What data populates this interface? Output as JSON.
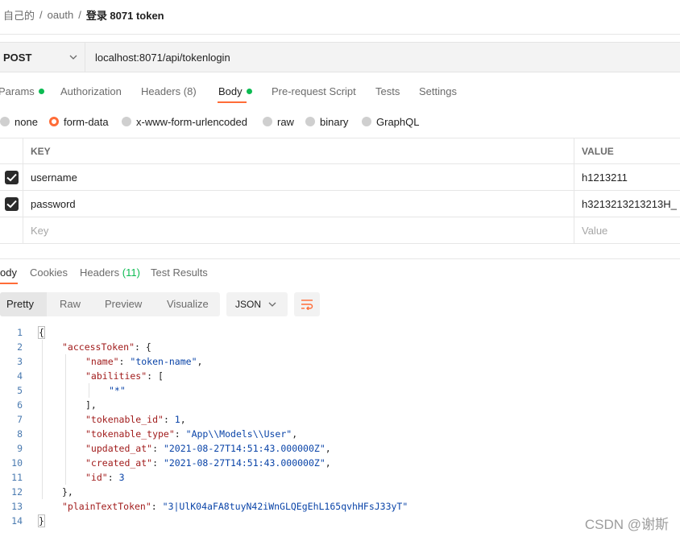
{
  "breadcrumb": {
    "root": "自己的",
    "collection": "oauth",
    "current": "登录 8071 token"
  },
  "request": {
    "method": "POST",
    "url": "localhost:8071/api/tokenlogin"
  },
  "request_tabs": [
    {
      "label": "Params",
      "dot": true
    },
    {
      "label": "Authorization"
    },
    {
      "label": "Headers",
      "count": "(8)"
    },
    {
      "label": "Body",
      "dot": true,
      "active": true
    },
    {
      "label": "Pre-request Script"
    },
    {
      "label": "Tests"
    },
    {
      "label": "Settings"
    }
  ],
  "body_types": [
    "none",
    "form-data",
    "x-www-form-urlencoded",
    "raw",
    "binary",
    "GraphQL"
  ],
  "body_type_selected": "form-data",
  "form_table": {
    "headers": {
      "key": "KEY",
      "value": "VALUE"
    },
    "rows": [
      {
        "key": "username",
        "value": "h1213211",
        "checked": true
      },
      {
        "key": "password",
        "value": "h3213213213213H_",
        "checked": true
      }
    ],
    "placeholder": {
      "key": "Key",
      "value": "Value"
    }
  },
  "response_tabs": [
    {
      "label": "ody",
      "active": true
    },
    {
      "label": "Cookies"
    },
    {
      "label": "Headers",
      "count": "(11)"
    },
    {
      "label": "Test Results"
    }
  ],
  "view_modes": [
    "Pretty",
    "Raw",
    "Preview",
    "Visualize"
  ],
  "view_selected": "Pretty",
  "format": "JSON",
  "code_lines": [
    "1",
    "2",
    "3",
    "4",
    "5",
    "6",
    "7",
    "8",
    "9",
    "10",
    "11",
    "12",
    "13",
    "14"
  ],
  "code": {
    "l1": "{",
    "l2_key": "\"accessToken\"",
    "l2_rest": ": {",
    "l3_key": "\"name\"",
    "l3_val": "\"token-name\"",
    "l4_key": "\"abilities\"",
    "l4_rest": ": [",
    "l5_val": "\"*\"",
    "l6": "],",
    "l7_key": "\"tokenable_id\"",
    "l7_val": "1",
    "l8_key": "\"tokenable_type\"",
    "l8_val": "\"App\\\\Models\\\\User\"",
    "l9_key": "\"updated_at\"",
    "l9_val": "\"2021-08-27T14:51:43.000000Z\"",
    "l10_key": "\"created_at\"",
    "l10_val": "\"2021-08-27T14:51:43.000000Z\"",
    "l11_key": "\"id\"",
    "l11_val": "3",
    "l12": "},",
    "l13_key": "\"plainTextToken\"",
    "l13_val": "\"3|UlK04aFA8tuyN42iWnGLQEgEhL165qvhHFsJ33yT\"",
    "l14": "}"
  },
  "watermark": "CSDN @谢斯",
  "colors": {
    "accent": "#ff6c37",
    "status_green": "#0cbb52",
    "json_key": "#a11c1c",
    "json_string": "#0a44a8"
  }
}
